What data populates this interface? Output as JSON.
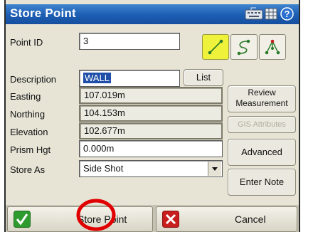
{
  "window": {
    "title": "Store Point"
  },
  "title_icons": [
    "keyboard-icon",
    "grid-icon",
    "help-icon"
  ],
  "form": {
    "point_id": {
      "label": "Point ID",
      "value": "3"
    },
    "description": {
      "label": "Description",
      "value": "WALL"
    },
    "easting": {
      "label": "Easting",
      "value": "107.019m"
    },
    "northing": {
      "label": "Northing",
      "value": "104.153m"
    },
    "elevation": {
      "label": "Elevation",
      "value": "102.677m"
    },
    "prism_hgt": {
      "label": "Prism Hgt",
      "value": "0.000m"
    },
    "store_as": {
      "label": "Store As",
      "value": "Side Shot"
    }
  },
  "buttons": {
    "list": "List",
    "review_line1": "Review",
    "review_line2": "Measurement",
    "gis": "GIS Attributes",
    "advanced": "Advanced",
    "enter_note": "Enter Note",
    "store_point": "Store Point",
    "cancel": "Cancel"
  },
  "mode_icons": [
    "line-mode-icon",
    "curve-mode-icon",
    "network-mode-icon"
  ],
  "colors": {
    "title_bar": "#1c5db3",
    "active_mode": "#eef23a",
    "ok": "#2e9b2e",
    "cancel": "#c81e1e",
    "annotation_circle": "#e00000"
  }
}
